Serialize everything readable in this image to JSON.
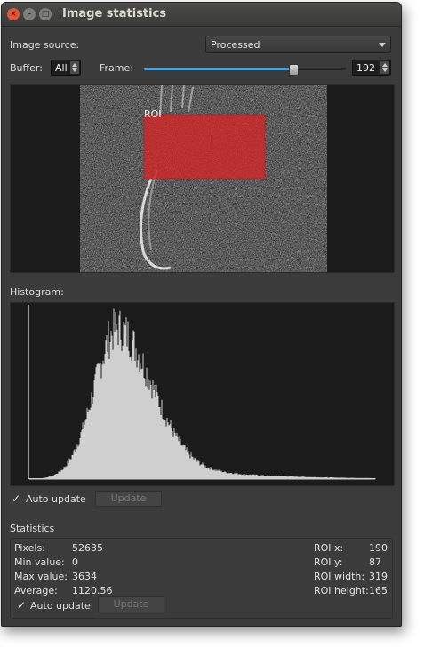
{
  "window": {
    "title": "Image statistics",
    "controls": {
      "close": "×",
      "minimize": "–",
      "maximize": "□"
    }
  },
  "source": {
    "label": "Image source:",
    "selected": "Processed"
  },
  "buffer": {
    "label": "Buffer:",
    "value": "All"
  },
  "frame": {
    "label": "Frame:",
    "value": "192",
    "slider_fraction": 0.74
  },
  "image_view": {
    "roi_label": "ROI",
    "roi_color": "#e02020"
  },
  "histogram": {
    "label": "Histogram:",
    "auto_update_label": "Auto update",
    "auto_update_checked": true,
    "update_button": "Update",
    "bar_color": "#cfcfcf"
  },
  "statistics": {
    "label": "Statistics",
    "pixels_label": "Pixels:",
    "pixels": "52635",
    "min_label": "Min value:",
    "min": "0",
    "max_label": "Max value:",
    "max": "3634",
    "avg_label": "Average:",
    "avg": "1120.56",
    "roi_x_label": "ROI x:",
    "roi_x": "190",
    "roi_y_label": "ROI y:",
    "roi_y": "87",
    "roi_w_label": "ROI width:",
    "roi_w": "319",
    "roi_h_label": "ROI height:",
    "roi_h": "165",
    "auto_update_label": "Auto update",
    "auto_update_checked": true,
    "update_button": "Update"
  }
}
